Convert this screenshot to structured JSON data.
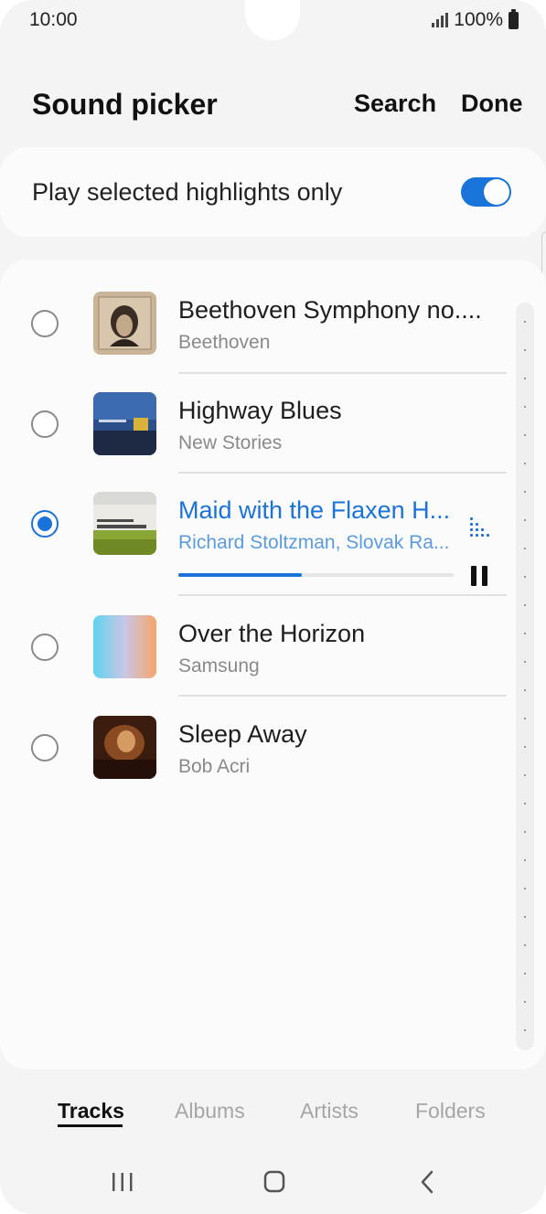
{
  "status": {
    "time": "10:00",
    "battery": "100%"
  },
  "header": {
    "title": "Sound picker",
    "search_label": "Search",
    "done_label": "Done"
  },
  "highlights": {
    "label": "Play selected highlights only",
    "enabled": true
  },
  "tracks": [
    {
      "title": "Beethoven Symphony no....",
      "artist": "Beethoven",
      "selected": false
    },
    {
      "title": "Highway Blues",
      "artist": "New Stories",
      "selected": false
    },
    {
      "title": "Maid with the Flaxen H...",
      "artist": "Richard Stoltzman, Slovak Ra...",
      "selected": true,
      "progress": 0.45
    },
    {
      "title": "Over the Horizon",
      "artist": "Samsung",
      "selected": false
    },
    {
      "title": "Sleep Away",
      "artist": "Bob Acri",
      "selected": false
    }
  ],
  "tabs": [
    "Tracks",
    "Albums",
    "Artists",
    "Folders"
  ],
  "active_tab": "Tracks",
  "colors": {
    "accent": "#1a73d9",
    "background": "#f4f4f4",
    "card": "#fbfbfb"
  },
  "icons": {
    "nav": [
      "recents-icon",
      "home-icon",
      "back-icon"
    ],
    "now_playing": "equalizer-icon",
    "playback": "pause-icon"
  }
}
